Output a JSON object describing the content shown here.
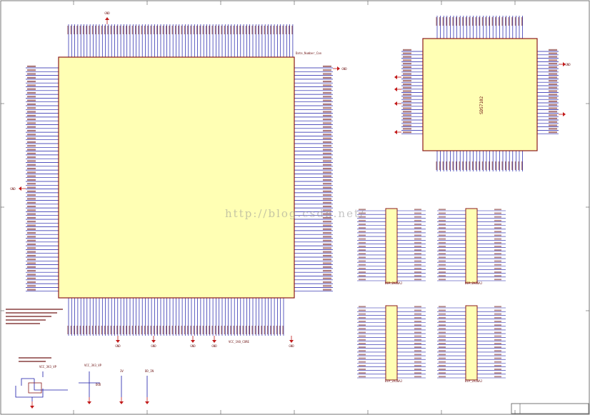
{
  "colors": {
    "component_fill": "#ffffb4",
    "component_border": "#8b1a1a",
    "wire": "#1a1aa8",
    "label": "#6a0f0f",
    "ground": "#c21a1a",
    "frame": "#555555"
  },
  "labels": {
    "gnd": "GND",
    "big_chip_note": "Date_Number_Can",
    "right_chip_name": "SDS7102",
    "connector_name": "DIP_2X20AJ",
    "power_label_1": "VCC_3V3_VP",
    "power_label_2": "VCC_3V3_VP",
    "power_label_3": "VCC_3V3_VP",
    "label_3v": "3V",
    "label_dod": "DOD",
    "label_dd_in": "DD_IN",
    "bottom_power": "VCC_1V0_CORE",
    "watermark": "http://blog.csdn.net/"
  }
}
